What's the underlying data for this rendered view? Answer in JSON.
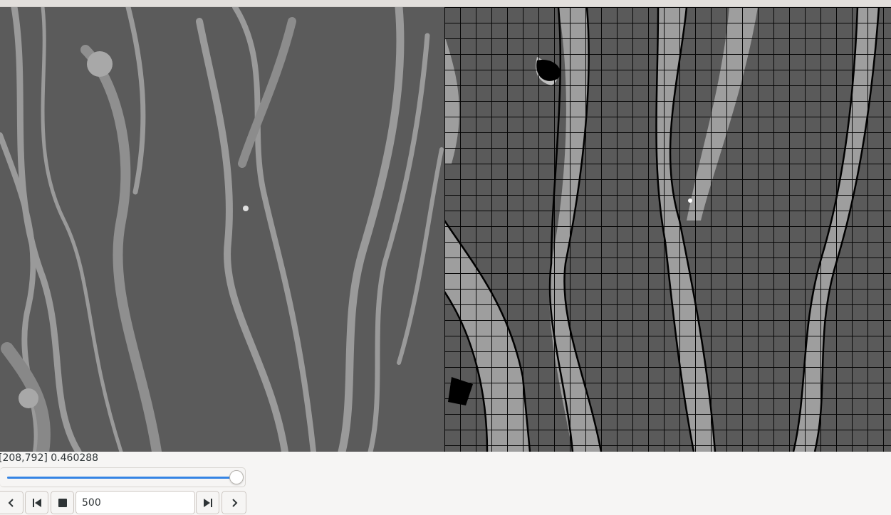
{
  "status": {
    "coordinate_readout": "[208,792] 0.460288"
  },
  "slider": {
    "value_fraction": 1.0
  },
  "player": {
    "frame_value": "500",
    "buttons": {
      "prev": "chevron-left-icon",
      "first": "skip-to-start-icon",
      "stop": "stop-icon",
      "last": "skip-to-end-icon",
      "next": "chevron-right-icon"
    }
  },
  "colors": {
    "accent": "#3584e4",
    "background": "#f6f5f4",
    "image_gray": "#5a5a5a",
    "overlay_lines": "#000000"
  }
}
